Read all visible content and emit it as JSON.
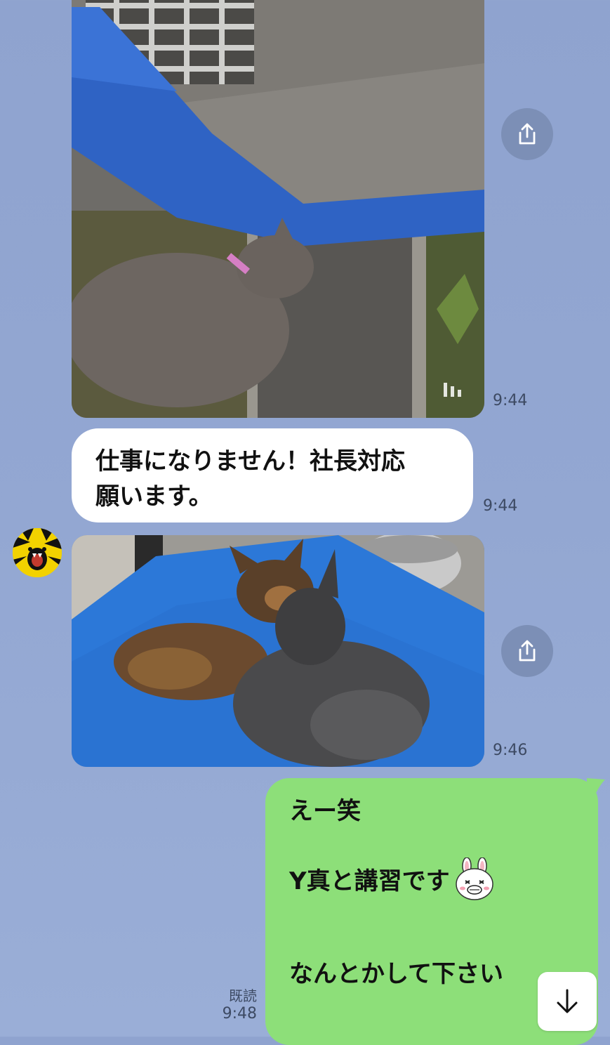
{
  "messages": {
    "video_1": {
      "time": "9:44",
      "type": "video"
    },
    "text_1": {
      "line_1": "仕事になりません！社長対応",
      "line_2": "願います。",
      "time": "9:44"
    },
    "photo_2": {
      "time": "9:46",
      "type": "photo"
    },
    "reply": {
      "line_1": "えー笑",
      "line_2": "Y真と講習です",
      "line_3": "なんとかして下さい",
      "read_label": "既読",
      "time": "9:48",
      "sticker": "brown-bunny-emoji"
    }
  },
  "icons": {
    "share": "share-icon",
    "scroll_down": "arrow-down-icon",
    "avatar": "tiger-avatar"
  },
  "colors": {
    "background": "#8fa3cf",
    "incoming_bubble": "#ffffff",
    "outgoing_bubble": "#8ddf79",
    "share_button": "#7c8fb6"
  }
}
